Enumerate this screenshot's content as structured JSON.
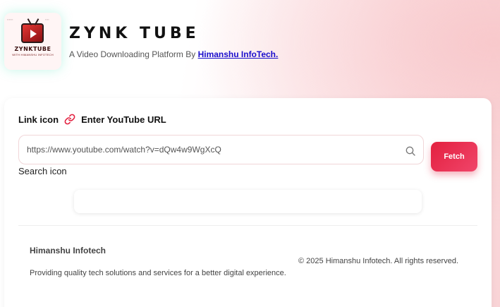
{
  "header": {
    "logo": {
      "name": "ZYNKTUBE",
      "subtitle": "WITH HIMANSHU INFOTECH"
    },
    "title": "ZYNK TUBE",
    "tagline_prefix": "A Video Downloading Platform By ",
    "tagline_link": "Himanshu InfoTech."
  },
  "form": {
    "label_prefix": "Link icon",
    "label_text": "Enter YouTube URL",
    "link_icon": "link-icon",
    "input_value": "https://www.youtube.com/watch?v=dQw4w9WgXcQ",
    "search_icon": "search-icon",
    "search_alt": "Search icon",
    "fetch_label": "Fetch"
  },
  "footer": {
    "company": "Himanshu Infotech",
    "description": "Providing quality tech solutions and services for a better digital experience.",
    "copyright": "© 2025 Himanshu Infotech. All rights reserved."
  },
  "colors": {
    "accent": "#e3203f",
    "link": "#1a0dcc"
  }
}
